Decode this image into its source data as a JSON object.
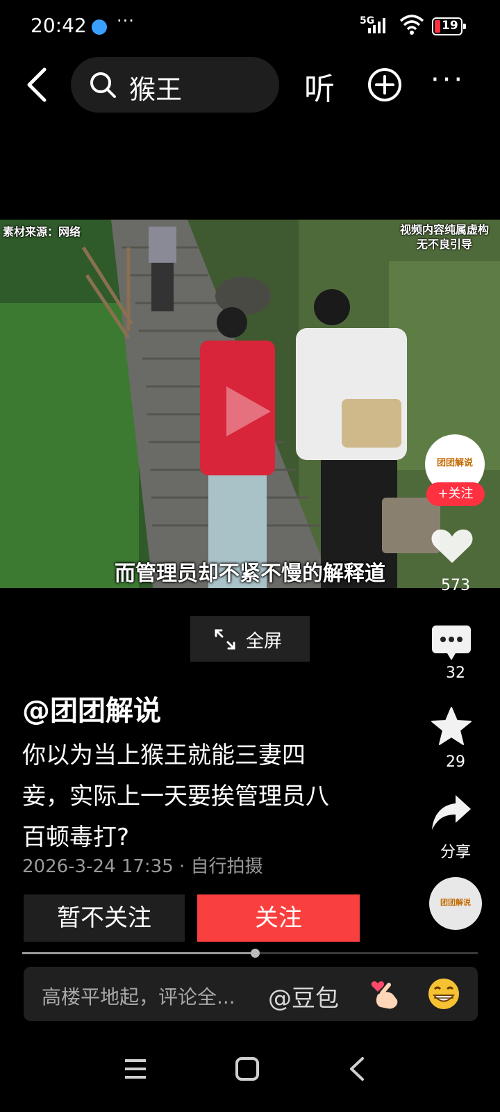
{
  "status_bar": {
    "time": "20:42",
    "more": "···",
    "network": "5G",
    "battery": "19"
  },
  "nav": {
    "search_query": "猴王",
    "listen_label": "听",
    "more_label": "···"
  },
  "video": {
    "source_label": "素材来源：网络",
    "disclaimer_line1": "视频内容纯属虚构",
    "disclaimer_line2": "无不良引导",
    "subtitle": "而管理员却不紧不慢的解释道"
  },
  "rail": {
    "avatar_text": "团团解说",
    "follow_pill": "+关注",
    "likes": "573",
    "comments": "32",
    "favorites": "29",
    "share_label": "分享",
    "music_text": "团团解说"
  },
  "fullscreen_label": "全屏",
  "post": {
    "author": "@团团解说",
    "desc_line1": "你以为当上猴王就能三妻四",
    "desc_line2": "妾，实际上一天要挨管理员八",
    "desc_line3": "百顿毒打?",
    "meta": "2026-3-24 17:35 · 自行拍摄"
  },
  "buttons": {
    "no_follow": "暂不关注",
    "follow": "关注"
  },
  "progress": 0.51,
  "comment": {
    "placeholder": "高楼平地起，评论全...",
    "mention": "@豆包"
  },
  "colors": {
    "accent_red": "#fa3f3f",
    "background": "#000000"
  }
}
